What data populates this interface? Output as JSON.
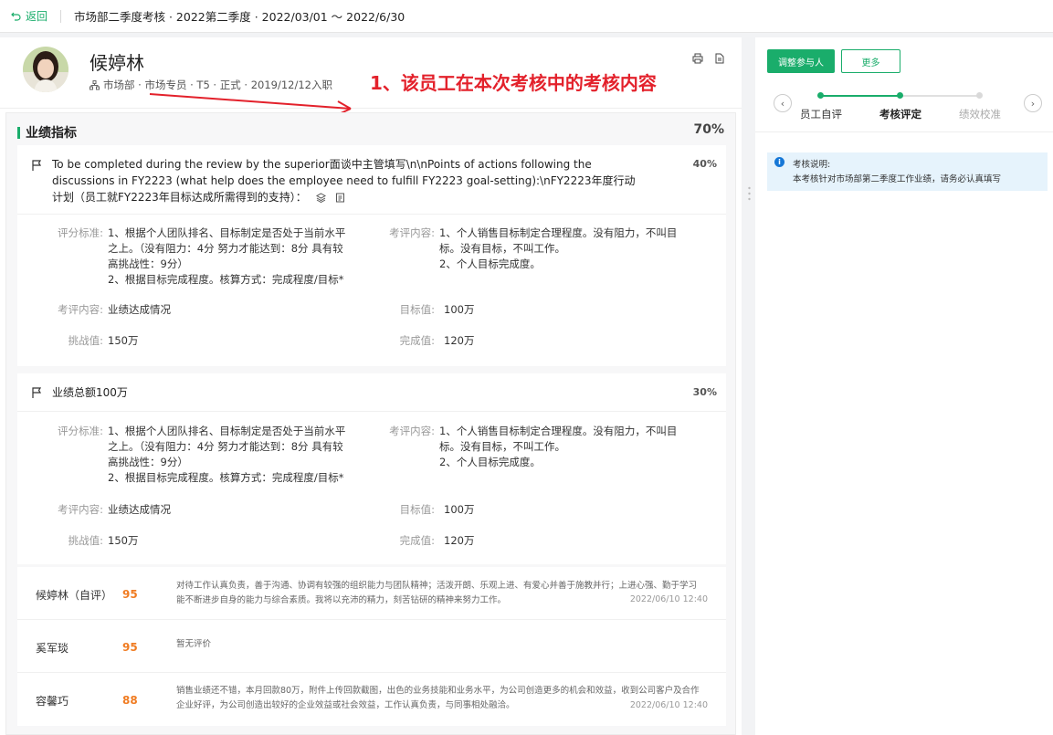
{
  "topbar": {
    "back_label": "返回",
    "title": "市场部二季度考核 · 2022第二季度 · 2022/03/01 ～ 2022/6/30"
  },
  "employee": {
    "name": "候婷林",
    "meta": "市场部 · 市场专员 · T5 · 正式 · 2019/12/12入职"
  },
  "annotation": "1、该员工在本次考核中的考核内容",
  "section": {
    "title": "业绩指标",
    "percent": "70%"
  },
  "items": [
    {
      "title_lines": [
        "To be completed during the review by the superior面谈中主管填写\\n\\nPoints of actions following the",
        "discussions in FY2223 (what help does the employee need to fulfill FY2223 goal-setting):\\nFY2223年度行动",
        "计划（员工就FY2223年目标达成所需得到的支持）："
      ],
      "percent": "40%",
      "criteria_label": "评分标准:",
      "criteria_lines": [
        "1、根据个人团队排名、目标制定是否处于当前水平",
        "之上。（没有阻力：4分 努力才能达到：8分 具有较",
        "高挑战性：9分）",
        "2、根据目标完成程度。核算方式：完成程度/目标*"
      ],
      "content_label": "考评内容:",
      "content_lines": [
        "1、个人销售目标制定合理程度。没有阻力，不叫目",
        "标。没有目标，不叫工作。",
        "2、个人目标完成度。"
      ],
      "review_label": "考评内容:",
      "review_value": "业绩达成情况",
      "target_label": "目标值:",
      "target_value": "100万",
      "challenge_label": "挑战值:",
      "challenge_value": "150万",
      "done_label": "完成值:",
      "done_value": "120万"
    },
    {
      "title_lines": [
        "业绩总额100万"
      ],
      "percent": "30%",
      "criteria_label": "评分标准:",
      "criteria_lines": [
        "1、根据个人团队排名、目标制定是否处于当前水平",
        "之上。（没有阻力：4分 努力才能达到：8分 具有较",
        "高挑战性：9分）",
        "2、根据目标完成程度。核算方式：完成程度/目标*"
      ],
      "content_label": "考评内容:",
      "content_lines": [
        "1、个人销售目标制定合理程度。没有阻力，不叫目",
        "标。没有目标，不叫工作。",
        "2、个人目标完成度。"
      ],
      "review_label": "考评内容:",
      "review_value": "业绩达成情况",
      "target_label": "目标值:",
      "target_value": "100万",
      "challenge_label": "挑战值:",
      "challenge_value": "150万",
      "done_label": "完成值:",
      "done_value": "120万"
    }
  ],
  "reviews": [
    {
      "name": "候婷林（自评）",
      "score": "95",
      "text_lines": [
        "对待工作认真负责，善于沟通、协调有较强的组织能力与团队精神；活泼开朗、乐观上进、有爱心并善于施教并行；上进心强、勤于学习",
        "能不断进步自身的能力与综合素质。我将以充沛的精力，刻苦钻研的精神来努力工作。"
      ],
      "date": "2022/06/10  12:40"
    },
    {
      "name": "奚军琰",
      "score": "95",
      "text_lines": [
        "暂无评价"
      ],
      "date": ""
    },
    {
      "name": "容馨巧",
      "score": "88",
      "text_lines": [
        "销售业绩还不错，本月回款80万，附件上传回款截图，出色的业务技能和业务水平，为公司创造更多的机会和效益，收到公司客户及合作",
        "企业好评，为公司创造出较好的企业效益或社会效益，工作认真负责，与同事相处融洽。"
      ],
      "date": "2022/06/10  12:40"
    }
  ],
  "sidebar": {
    "adjust_button": "调整参与人",
    "more_button": "更多",
    "steps": [
      "员工自评",
      "考核评定",
      "绩效校准"
    ],
    "info_title": "考核说明:",
    "info_text": "本考核针对市场部第二季度工作业绩，请务必认真填写"
  },
  "colors": {
    "accent": "#1aad6b",
    "score": "#f07c22",
    "annotation": "#e3212b"
  }
}
